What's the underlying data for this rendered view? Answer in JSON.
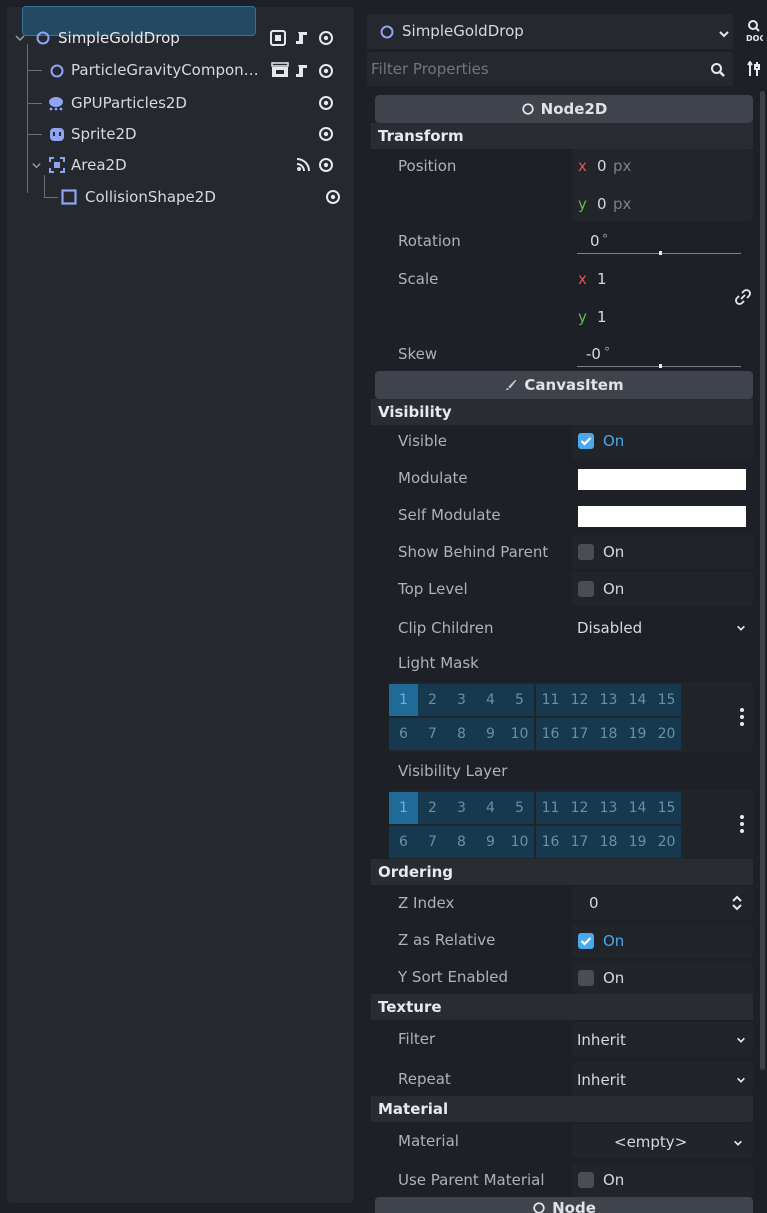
{
  "scene_tree": {
    "nodes": [
      {
        "name": "SimpleGoldDrop",
        "icon": "node2d-circle-icon",
        "selected": true
      },
      {
        "name": "ParticleGravityCompon…",
        "icon": "node2d-circle-icon"
      },
      {
        "name": "GPUParticles2D",
        "icon": "gpu-particles-icon"
      },
      {
        "name": "Sprite2D",
        "icon": "sprite2d-icon"
      },
      {
        "name": "Area2D",
        "icon": "area2d-icon"
      },
      {
        "name": "CollisionShape2D",
        "icon": "collision-shape-icon"
      }
    ]
  },
  "inspector": {
    "object_name": "SimpleGoldDrop",
    "filter_placeholder": "Filter Properties",
    "sections": {
      "node2d": "Node2D",
      "canvas_item": "CanvasItem",
      "node": "Node"
    },
    "categories": {
      "transform": "Transform",
      "visibility": "Visibility",
      "ordering": "Ordering",
      "texture": "Texture",
      "material": "Material"
    },
    "transform": {
      "position_label": "Position",
      "position_x_axis": "x",
      "position_x": "0",
      "position_x_unit": "px",
      "position_y_axis": "y",
      "position_y": "0",
      "position_y_unit": "px",
      "rotation_label": "Rotation",
      "rotation": "0",
      "rotation_unit": "°",
      "scale_label": "Scale",
      "scale_x_axis": "x",
      "scale_x": "1",
      "scale_y_axis": "y",
      "scale_y": "1",
      "skew_label": "Skew",
      "skew": "-0",
      "skew_unit": "°"
    },
    "visibility": {
      "visible_label": "Visible",
      "visible_value": "On",
      "modulate_label": "Modulate",
      "modulate_color": "#ffffff",
      "self_modulate_label": "Self Modulate",
      "self_modulate_color": "#ffffff",
      "show_behind_label": "Show Behind Parent",
      "show_behind_value": "On",
      "top_level_label": "Top Level",
      "top_level_value": "On",
      "clip_children_label": "Clip Children",
      "clip_children_value": "Disabled",
      "light_mask_label": "Light Mask",
      "visibility_layer_label": "Visibility Layer"
    },
    "layer_grid": {
      "row1": [
        "1",
        "2",
        "3",
        "4",
        "5",
        "11",
        "12",
        "13",
        "14",
        "15"
      ],
      "row2": [
        "6",
        "7",
        "8",
        "9",
        "10",
        "16",
        "17",
        "18",
        "19",
        "20"
      ]
    },
    "ordering": {
      "z_index_label": "Z Index",
      "z_index": "0",
      "z_relative_label": "Z as Relative",
      "z_relative_value": "On",
      "y_sort_label": "Y Sort Enabled",
      "y_sort_value": "On"
    },
    "texture": {
      "filter_label": "Filter",
      "filter_value": "Inherit",
      "repeat_label": "Repeat",
      "repeat_value": "Inherit"
    },
    "material": {
      "material_label": "Material",
      "material_value": "<empty>",
      "use_parent_label": "Use Parent Material",
      "use_parent_value": "On"
    }
  },
  "colors": {
    "accent": "#4aa8ee",
    "x_axis": "#e5534b",
    "y_axis": "#5fbf4a",
    "selected_bg": "#244a63"
  }
}
